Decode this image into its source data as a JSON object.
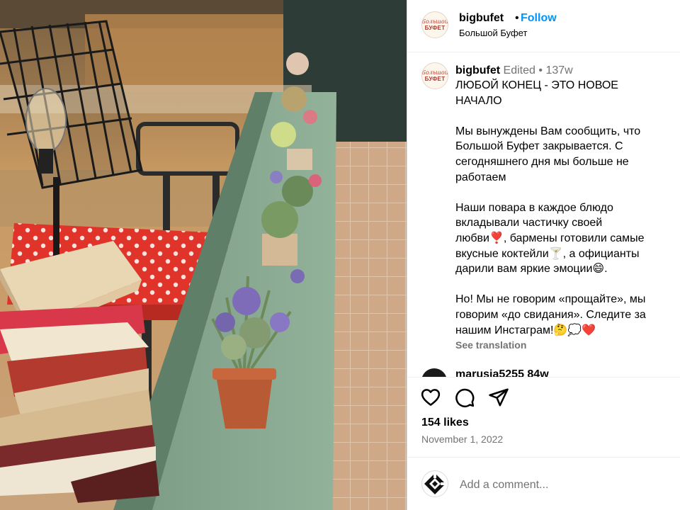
{
  "header": {
    "username": "bigbufet",
    "separator": "•",
    "follow_label": "Follow",
    "subtitle": "Большой Буфет"
  },
  "avatar_logo": {
    "line1": "Большой",
    "line2": "БУФЕТ"
  },
  "caption": {
    "username": "bigbufet",
    "edited": "Edited",
    "dot": "•",
    "age": "137w",
    "paragraphs": [
      "ЛЮБОЙ КОНЕЦ - ЭТО НОВОЕ\nНАЧАЛО",
      "Мы вынуждены Вам сообщить, что\nБольшой Буфет закрывается. С\nсегодняшнего дня мы больше не\nработаем",
      "Наши повара в каждое блюдо\nвкладывали частичку своей\nлюбви❣️, бармены готовили самые\nвкусные коктейли🍸, а официанты\nдарили вам яркие эмоции😄.",
      "Но! Мы не говорим «прощайте», мы\nговорим «до свидания». Следите за\nнашим Инстаграм!🤔💭❤️"
    ],
    "see_translation": "See translation"
  },
  "comment_preview": {
    "text": "marusia5255  84w"
  },
  "actions": {
    "like_icon": "heart-icon",
    "comment_icon": "comment-icon",
    "share_icon": "send-icon"
  },
  "stats": {
    "likes": "154 likes",
    "date": "November 1, 2022"
  },
  "add_comment": {
    "placeholder": "Add a comment..."
  },
  "colors": {
    "accent": "#0095f6",
    "secondary_text": "#737373",
    "divider": "#efefef"
  }
}
